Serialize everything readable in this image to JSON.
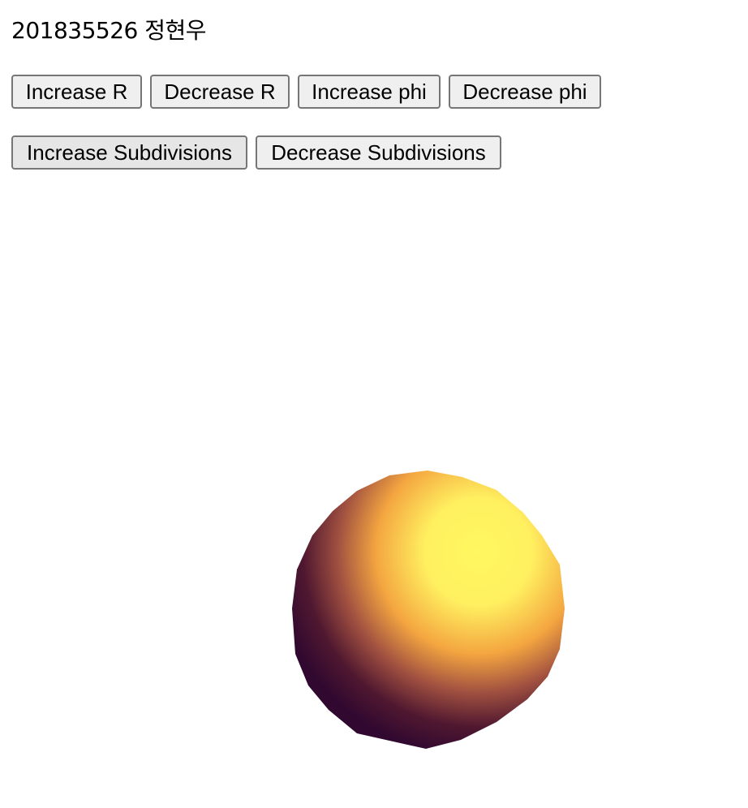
{
  "title": "201835526 정현우",
  "buttons_row1": {
    "increase_r": "Increase R",
    "decrease_r": "Decrease R",
    "increase_phi": "Increase phi",
    "decrease_phi": "Decrease phi"
  },
  "buttons_row2": {
    "increase_subdivisions": "Increase Subdivisions",
    "decrease_subdivisions": "Decrease Subdivisions"
  },
  "colors": {
    "sphere_highlight": "#fff860",
    "sphere_mid": "#f4a640",
    "sphere_shadow": "#300830"
  }
}
